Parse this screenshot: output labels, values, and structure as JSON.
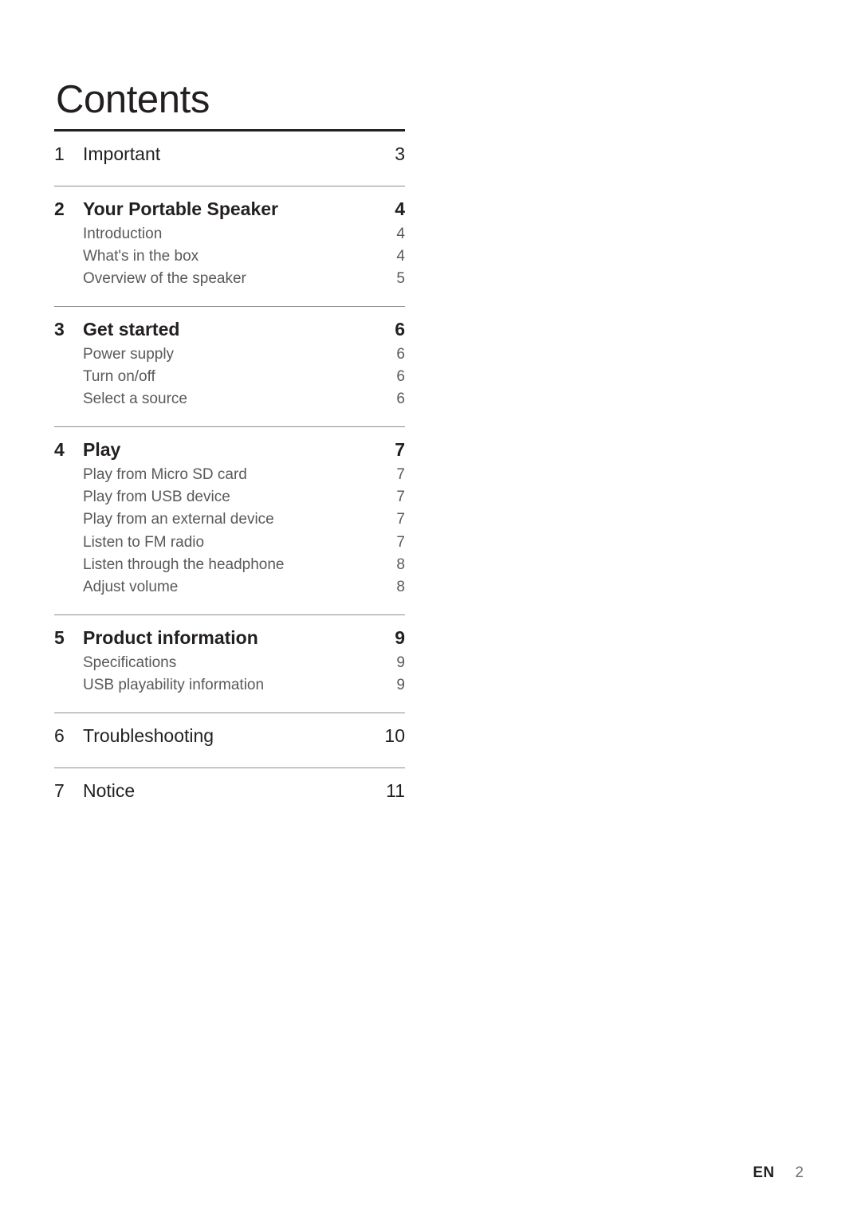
{
  "document": {
    "title": "Contents"
  },
  "toc": {
    "sections": [
      {
        "number": "1",
        "title": "Important",
        "page": "3",
        "weight": "regular",
        "subentries": []
      },
      {
        "number": "2",
        "title": "Your Portable Speaker",
        "page": "4",
        "weight": "bold",
        "subentries": [
          {
            "label": "Introduction",
            "page": "4"
          },
          {
            "label": "What's in the box",
            "page": "4"
          },
          {
            "label": "Overview of the speaker",
            "page": "5"
          }
        ]
      },
      {
        "number": "3",
        "title": "Get started",
        "page": "6",
        "weight": "bold",
        "subentries": [
          {
            "label": "Power supply",
            "page": "6"
          },
          {
            "label": "Turn on/off",
            "page": "6"
          },
          {
            "label": "Select a source",
            "page": "6"
          }
        ]
      },
      {
        "number": "4",
        "title": "Play",
        "page": "7",
        "weight": "bold",
        "subentries": [
          {
            "label": "Play from Micro SD card",
            "page": "7"
          },
          {
            "label": "Play from USB device",
            "page": "7"
          },
          {
            "label": "Play from an external device",
            "page": "7"
          },
          {
            "label": "Listen to FM radio",
            "page": "7"
          },
          {
            "label": "Listen through the headphone",
            "page": "8"
          },
          {
            "label": "Adjust volume",
            "page": "8"
          }
        ]
      },
      {
        "number": "5",
        "title": "Product information",
        "page": "9",
        "weight": "bold",
        "subentries": [
          {
            "label": "Specifications",
            "page": "9"
          },
          {
            "label": "USB playability information",
            "page": "9"
          }
        ]
      },
      {
        "number": "6",
        "title": "Troubleshooting",
        "page": "10",
        "weight": "regular",
        "subentries": []
      },
      {
        "number": "7",
        "title": "Notice",
        "page": "11",
        "weight": "regular",
        "subentries": []
      }
    ]
  },
  "footer": {
    "language": "EN",
    "page_number": "2"
  },
  "colors": {
    "text_primary": "#231f20",
    "text_secondary": "#58595b",
    "rule_top": "#231f20",
    "rule_section": "#8d8d8d"
  }
}
